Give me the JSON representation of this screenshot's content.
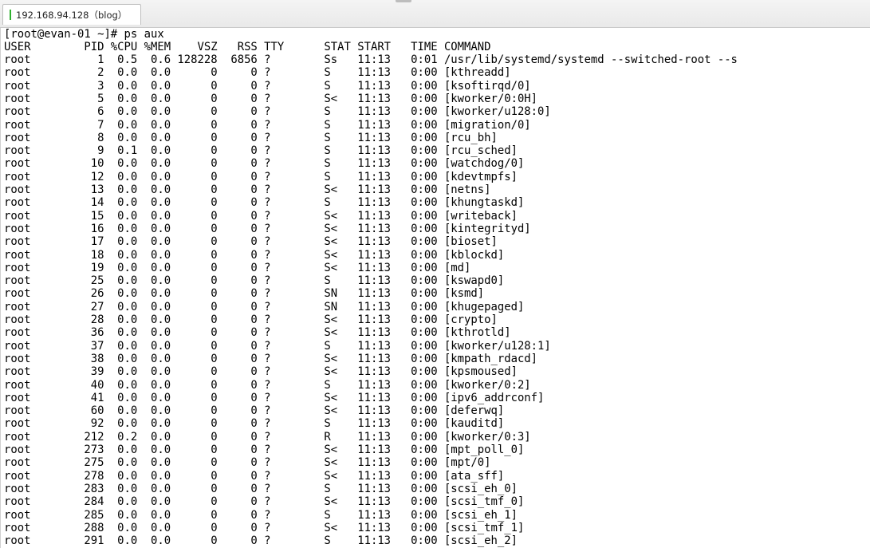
{
  "tab": {
    "title": "192.168.94.128（blog）"
  },
  "terminal": {
    "prompt_line": "[root@evan-01 ~]# ps aux",
    "header": "USER        PID %CPU %MEM    VSZ   RSS TTY      STAT START   TIME COMMAND",
    "rows": [
      "root          1  0.5  0.6 128228  6856 ?        Ss   11:13   0:01 /usr/lib/systemd/systemd --switched-root --s",
      "root          2  0.0  0.0      0     0 ?        S    11:13   0:00 [kthreadd]",
      "root          3  0.0  0.0      0     0 ?        S    11:13   0:00 [ksoftirqd/0]",
      "root          5  0.0  0.0      0     0 ?        S<   11:13   0:00 [kworker/0:0H]",
      "root          6  0.0  0.0      0     0 ?        S    11:13   0:00 [kworker/u128:0]",
      "root          7  0.0  0.0      0     0 ?        S    11:13   0:00 [migration/0]",
      "root          8  0.0  0.0      0     0 ?        S    11:13   0:00 [rcu_bh]",
      "root          9  0.1  0.0      0     0 ?        S    11:13   0:00 [rcu_sched]",
      "root         10  0.0  0.0      0     0 ?        S    11:13   0:00 [watchdog/0]",
      "root         12  0.0  0.0      0     0 ?        S    11:13   0:00 [kdevtmpfs]",
      "root         13  0.0  0.0      0     0 ?        S<   11:13   0:00 [netns]",
      "root         14  0.0  0.0      0     0 ?        S    11:13   0:00 [khungtaskd]",
      "root         15  0.0  0.0      0     0 ?        S<   11:13   0:00 [writeback]",
      "root         16  0.0  0.0      0     0 ?        S<   11:13   0:00 [kintegrityd]",
      "root         17  0.0  0.0      0     0 ?        S<   11:13   0:00 [bioset]",
      "root         18  0.0  0.0      0     0 ?        S<   11:13   0:00 [kblockd]",
      "root         19  0.0  0.0      0     0 ?        S<   11:13   0:00 [md]",
      "root         25  0.0  0.0      0     0 ?        S    11:13   0:00 [kswapd0]",
      "root         26  0.0  0.0      0     0 ?        SN   11:13   0:00 [ksmd]",
      "root         27  0.0  0.0      0     0 ?        SN   11:13   0:00 [khugepaged]",
      "root         28  0.0  0.0      0     0 ?        S<   11:13   0:00 [crypto]",
      "root         36  0.0  0.0      0     0 ?        S<   11:13   0:00 [kthrotld]",
      "root         37  0.0  0.0      0     0 ?        S    11:13   0:00 [kworker/u128:1]",
      "root         38  0.0  0.0      0     0 ?        S<   11:13   0:00 [kmpath_rdacd]",
      "root         39  0.0  0.0      0     0 ?        S<   11:13   0:00 [kpsmoused]",
      "root         40  0.0  0.0      0     0 ?        S    11:13   0:00 [kworker/0:2]",
      "root         41  0.0  0.0      0     0 ?        S<   11:13   0:00 [ipv6_addrconf]",
      "root         60  0.0  0.0      0     0 ?        S<   11:13   0:00 [deferwq]",
      "root         92  0.0  0.0      0     0 ?        S    11:13   0:00 [kauditd]",
      "root        212  0.2  0.0      0     0 ?        R    11:13   0:00 [kworker/0:3]",
      "root        273  0.0  0.0      0     0 ?        S<   11:13   0:00 [mpt_poll_0]",
      "root        275  0.0  0.0      0     0 ?        S<   11:13   0:00 [mpt/0]",
      "root        278  0.0  0.0      0     0 ?        S<   11:13   0:00 [ata_sff]",
      "root        283  0.0  0.0      0     0 ?        S    11:13   0:00 [scsi_eh_0]",
      "root        284  0.0  0.0      0     0 ?        S<   11:13   0:00 [scsi_tmf_0]",
      "root        285  0.0  0.0      0     0 ?        S    11:13   0:00 [scsi_eh_1]",
      "root        288  0.0  0.0      0     0 ?        S<   11:13   0:00 [scsi_tmf_1]",
      "root        291  0.0  0.0      0     0 ?        S    11:13   0:00 [scsi_eh_2]"
    ]
  },
  "colors": {
    "status_indicator": "#2fb12f",
    "terminal_bg": "#ffffff",
    "terminal_fg": "#000000"
  }
}
